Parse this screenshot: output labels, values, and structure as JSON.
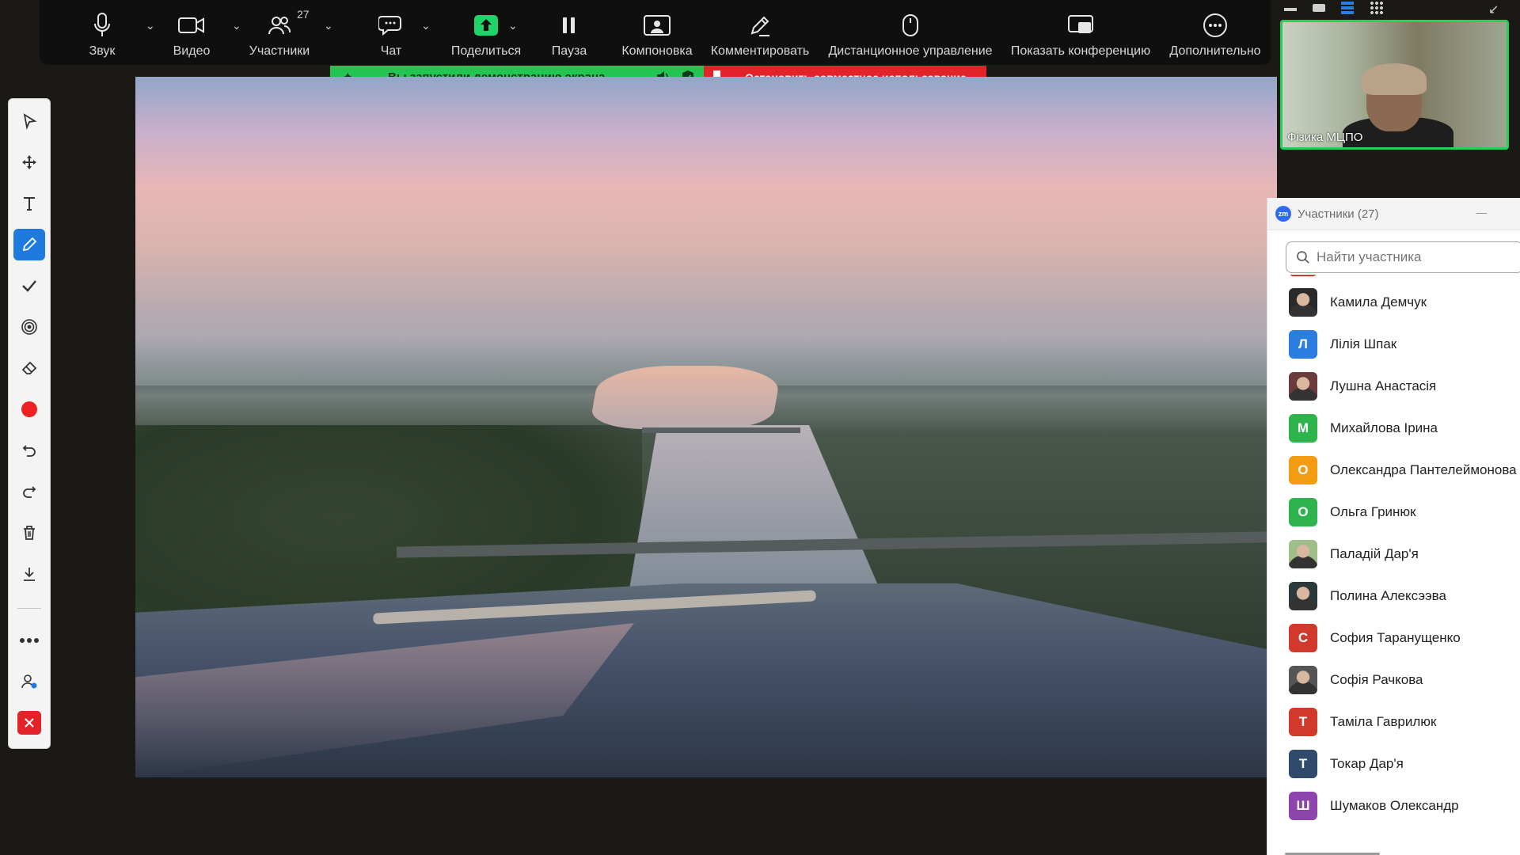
{
  "toolbar": {
    "audio_label": "Звук",
    "video_label": "Видео",
    "participants_label": "Участники",
    "participants_count": "27",
    "chat_label": "Чат",
    "share_label": "Поделиться",
    "pause_label": "Пауза",
    "layout_label": "Компоновка",
    "annotate_label": "Комментировать",
    "remote_label": "Дистанционное управление",
    "show_conf_label": "Показать конференцию",
    "more_label": "Дополнительно"
  },
  "share_banner": {
    "status_text": "Вы запустили демонстрацию экрана",
    "stop_label": "Остановить совместное использование"
  },
  "video_tile": {
    "name": "Фізика МЦПО"
  },
  "panel": {
    "logo_text": "zm",
    "title": "Участники (27)",
    "minimize_label": "—",
    "search_placeholder": "Найти участника",
    "participants": [
      {
        "name": "Камила Демчук",
        "initial": "",
        "color": "#2a2a2a"
      },
      {
        "name": "Лілія Шпак",
        "initial": "Л",
        "color": "#2b7de0"
      },
      {
        "name": "Лушна Анастасія",
        "initial": "",
        "color": "#6b3a3a"
      },
      {
        "name": "Михайлова Ірина",
        "initial": "М",
        "color": "#2fb34c"
      },
      {
        "name": "Олександра Пантелеймонова",
        "initial": "О",
        "color": "#f39c12"
      },
      {
        "name": "Ольга Гринюк",
        "initial": "О",
        "color": "#2fb34c"
      },
      {
        "name": "Паладій Дар'я",
        "initial": "",
        "color": "#9fbf8a"
      },
      {
        "name": "Полина Алексээва",
        "initial": "",
        "color": "#2a3a3a"
      },
      {
        "name": "София Таранущенко",
        "initial": "С",
        "color": "#d0392b"
      },
      {
        "name": "Софія Рачкова",
        "initial": "",
        "color": "#555555"
      },
      {
        "name": "Таміла Гаврилюк",
        "initial": "Т",
        "color": "#d0392b"
      },
      {
        "name": "Токар Дар'я",
        "initial": "Т",
        "color": "#2f4a6a"
      },
      {
        "name": "Шумаков Олександр",
        "initial": "Ш",
        "color": "#8e44ad"
      }
    ]
  },
  "colors": {
    "share_green": "#23c552",
    "stop_red": "#e2242a",
    "active_speaker": "#26d15a",
    "annotate_active": "#1f7ae0"
  }
}
